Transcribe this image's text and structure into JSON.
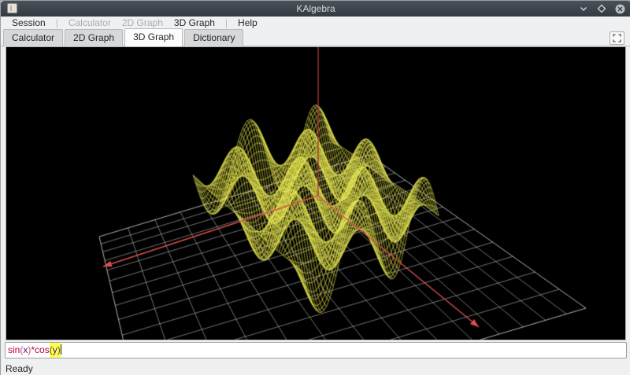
{
  "titlebar": {
    "title": "KAlgebra",
    "buttons": [
      {
        "name": "minimize-button",
        "icon": "chevron-down-icon"
      },
      {
        "name": "maximize-button",
        "icon": "diamond-icon"
      },
      {
        "name": "close-button",
        "icon": "circle-x-icon"
      }
    ]
  },
  "menubar": {
    "items": [
      {
        "type": "item",
        "label": "Session",
        "enabled": true
      },
      {
        "type": "separator",
        "label": "|"
      },
      {
        "type": "item",
        "label": "Calculator",
        "enabled": false
      },
      {
        "type": "item",
        "label": "2D Graph",
        "enabled": false
      },
      {
        "type": "item",
        "label": "3D Graph",
        "enabled": true
      },
      {
        "type": "separator",
        "label": "|"
      },
      {
        "type": "item",
        "label": "Help",
        "enabled": true
      }
    ]
  },
  "tabbar": {
    "tabs": [
      "Calculator",
      "2D Graph",
      "3D Graph",
      "Dictionary"
    ],
    "active_index": 2,
    "fullscreen_button": {
      "icon": "fullscreen-icon"
    }
  },
  "plot": {
    "type": "surface3d-wireframe",
    "expression": "sin(x)*cos(y)",
    "surface_domain": "x,y in [-2pi, 2pi]",
    "grid_cells": 14,
    "background": "#000000",
    "surface_color": "rgba(214,214,58,0.55)",
    "surface_color_bright": "rgba(235,235,90,0.25)",
    "grid_color": "rgba(205,205,210,0.55)",
    "grid_border_color": "rgba(220,220,225,0.8)",
    "axis_xy_color": "#d95050",
    "axis_z_color": "#a33535"
  },
  "input": {
    "tokens": [
      {
        "text": "sin",
        "color": "#b8003c"
      },
      {
        "text": "(",
        "color": "#d4406a"
      },
      {
        "text": "x",
        "color": "#4a1080"
      },
      {
        "text": ")",
        "color": "#d4406a"
      },
      {
        "text": "*",
        "color": "#b8003c"
      },
      {
        "text": "cos",
        "color": "#b8003c"
      },
      {
        "text": "(",
        "color": "#5a5a00",
        "bg": "#ffff55"
      },
      {
        "text": "y",
        "color": "#4a1080",
        "bg": "#ffff55"
      },
      {
        "text": ")",
        "color": "#5a5a00",
        "bg": "#ffff55"
      }
    ],
    "caret": true
  },
  "statusbar": {
    "text": "Ready"
  }
}
